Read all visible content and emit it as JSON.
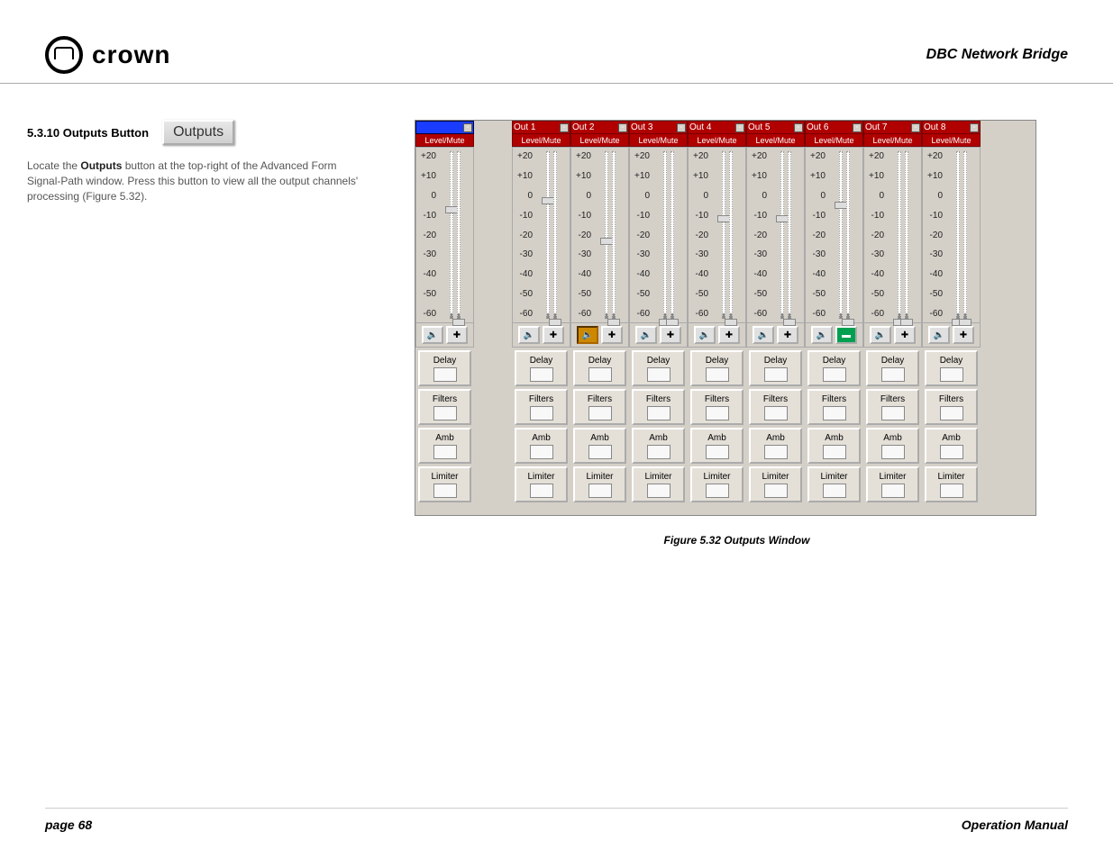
{
  "header": {
    "brand": "crown",
    "doc_title": "DBC Network Bridge"
  },
  "section": {
    "number": "5.3.10 Outputs Button",
    "button_label": "Outputs",
    "body_pre": "Locate the ",
    "body_bold": "Outputs",
    "body_post": " button at the top-right of the Advanced Form Signal-Path window. Press this button to view all the output channels' processing (Figure 5.32)."
  },
  "scale": [
    "+20",
    "+10",
    "0",
    "-10",
    "-20",
    "-30",
    "-40",
    "-50",
    "-60"
  ],
  "level_mute": "Level/Mute",
  "master": {
    "title": "",
    "thumb1": 60,
    "thumb2": 185
  },
  "channels": [
    {
      "title": "Out 1",
      "thumb1": 50,
      "thumb2": 185,
      "mute": false,
      "plus": true
    },
    {
      "title": "Out 2",
      "thumb1": 95,
      "thumb2": 185,
      "mute": true,
      "plus": true
    },
    {
      "title": "Out 3",
      "thumb1": 185,
      "thumb2": 185,
      "mute": false,
      "plus": true
    },
    {
      "title": "Out 4",
      "thumb1": 70,
      "thumb2": 185,
      "mute": false,
      "plus": true
    },
    {
      "title": "Out 5",
      "thumb1": 70,
      "thumb2": 185,
      "mute": false,
      "plus": true
    },
    {
      "title": "Out 6",
      "thumb1": 55,
      "thumb2": 185,
      "mute": false,
      "dash": true
    },
    {
      "title": "Out 7",
      "thumb1": 185,
      "thumb2": 185,
      "mute": false,
      "plus": true
    },
    {
      "title": "Out 8",
      "thumb1": 185,
      "thumb2": 185,
      "mute": false,
      "plus": true
    }
  ],
  "proc": {
    "delay": "Delay",
    "filters": "Filters",
    "amb": "Amb",
    "limiter": "Limiter"
  },
  "caption": "Figure 5.32  Outputs Window",
  "footer": {
    "page": "page 68",
    "manual": "Operation Manual"
  }
}
